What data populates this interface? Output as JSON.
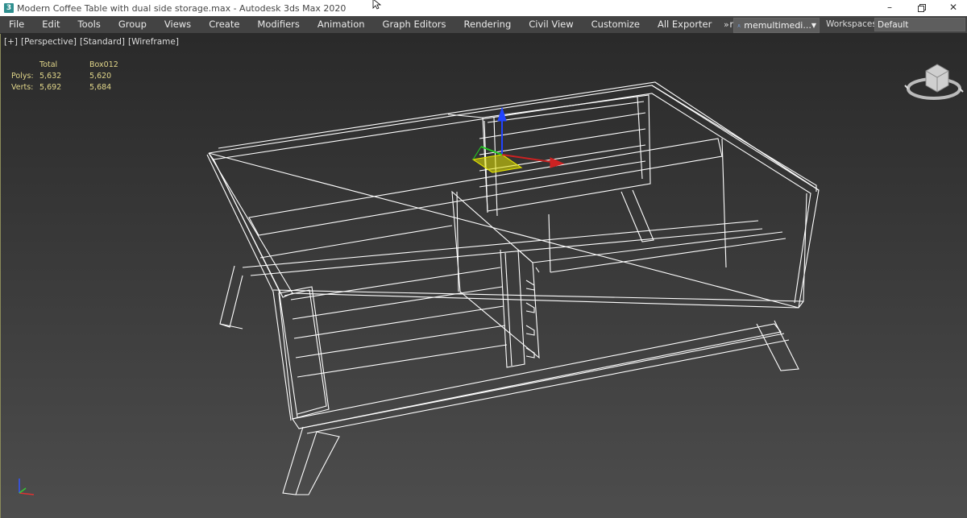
{
  "titlebar": {
    "app_icon_text": "3",
    "title": "Modern Coffee Table with dual side storage.max - Autodesk 3ds Max 2020",
    "minimize_icon": "minimize-icon",
    "restore_icon": "restore-icon",
    "close_icon": "close-icon"
  },
  "menubar": {
    "items": [
      "File",
      "Edit",
      "Tools",
      "Group",
      "Views",
      "Create",
      "Modifiers",
      "Animation",
      "Graph Editors",
      "Rendering",
      "Civil View",
      "Customize",
      "All Exporter",
      "rapid Tools"
    ],
    "overflow": "»",
    "user": "memultimedi...",
    "workspaces_label": "Workspaces:",
    "workspace": "Default"
  },
  "viewport": {
    "labels": [
      "[+]",
      "[Perspective]",
      "[Standard]",
      "[Wireframe]"
    ],
    "stats": {
      "header_total": "Total",
      "header_object": "Box012",
      "polys_label": "Polys:",
      "polys_total": "5,632",
      "polys_object": "5,620",
      "verts_label": "Verts:",
      "verts_total": "5,692",
      "verts_object": "5,684"
    },
    "colors": {
      "wire": "#ffffff",
      "stats": "#e1d68a",
      "gizmo_x": "#cc2222",
      "gizmo_y": "#22cc22",
      "gizmo_z": "#2244ff",
      "gizmo_plane": "#e6e600"
    }
  }
}
